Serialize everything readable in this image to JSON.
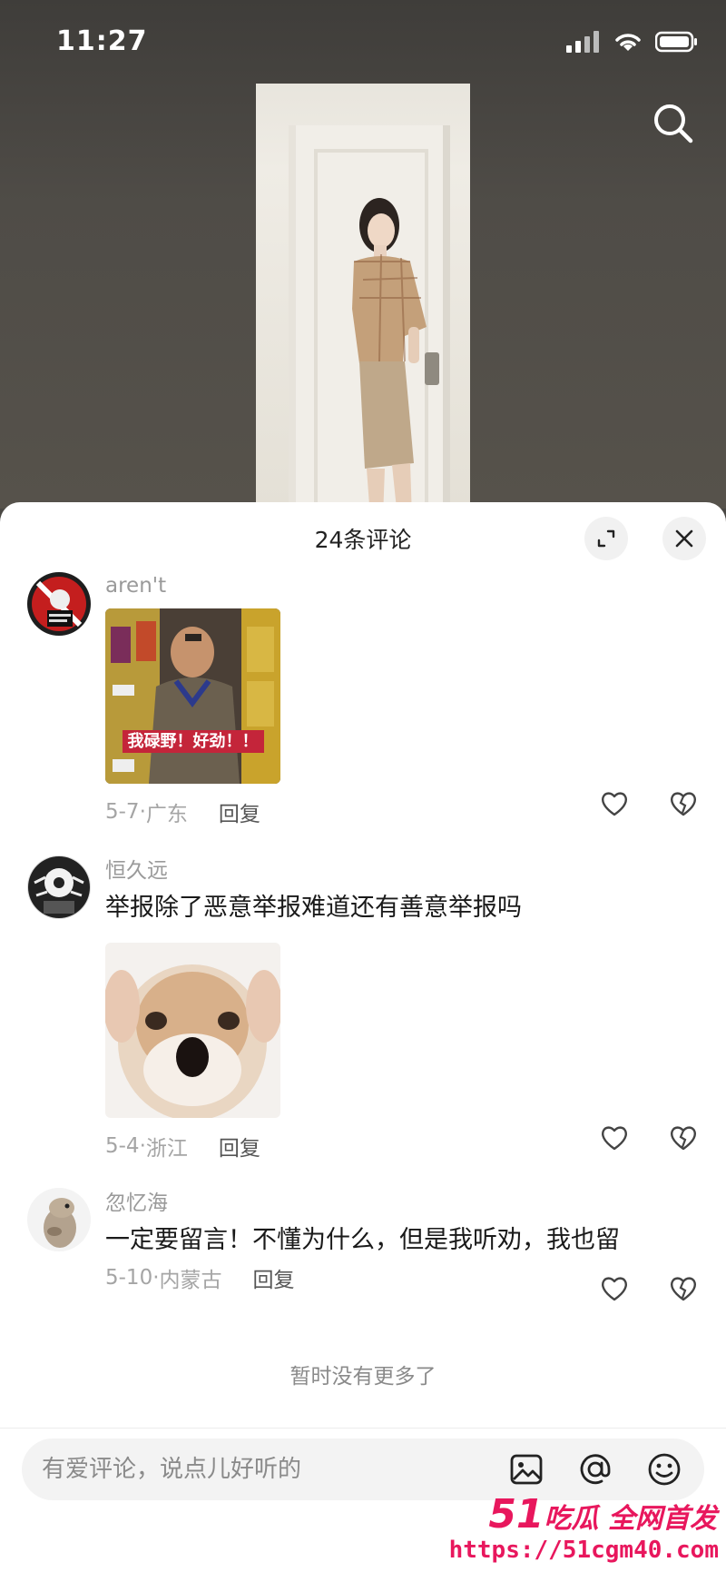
{
  "status_bar": {
    "time": "11:27"
  },
  "sheet": {
    "title": "24条评论"
  },
  "comments": [
    {
      "username": "aren't",
      "text": "",
      "image_caption": "我碌野！好劲！！",
      "date": "5-7",
      "location": "广东",
      "reply_label": "回复"
    },
    {
      "username": "恒久远",
      "text": "举报除了恶意举报难道还有善意举报吗",
      "date": "5-4",
      "location": "浙江",
      "reply_label": "回复"
    },
    {
      "username": "忽忆海",
      "text": "一定要留言！不懂为什么，但是我听劝，我也留",
      "date": "5-10",
      "location": "内蒙古",
      "reply_label": "回复"
    }
  ],
  "no_more_text": "暂时没有更多了",
  "input": {
    "placeholder": "有爱评论，说点儿好听的"
  },
  "watermark": {
    "brand_number": "51",
    "brand_text": "吃瓜 全网首发",
    "url": "https://51cgm40.com"
  },
  "colors": {
    "watermark": "#e8175d",
    "sheet_bg": "#ffffff"
  }
}
